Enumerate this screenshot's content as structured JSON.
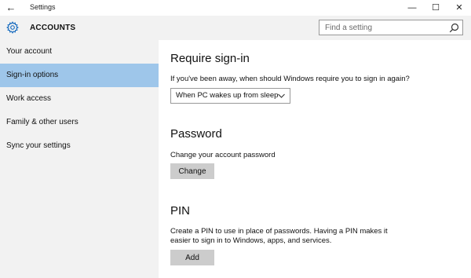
{
  "window": {
    "title": "Settings",
    "minimize_glyph": "—",
    "maximize_glyph": "☐",
    "close_glyph": "✕",
    "back_glyph": "←"
  },
  "header": {
    "icon": "gear-icon",
    "title": "ACCOUNTS"
  },
  "search": {
    "placeholder": "Find a setting",
    "icon": "search-icon"
  },
  "sidebar": {
    "items": [
      {
        "label": "Your account"
      },
      {
        "label": "Sign-in options",
        "selected": true
      },
      {
        "label": "Work access"
      },
      {
        "label": "Family & other users"
      },
      {
        "label": "Sync your settings"
      }
    ]
  },
  "content": {
    "require_signin": {
      "title": "Require sign-in",
      "question": "If you've been away, when should Windows require you to sign in again?",
      "selected_option": "When PC wakes up from sleep"
    },
    "password": {
      "title": "Password",
      "description": "Change your account password",
      "button_label": "Change"
    },
    "pin": {
      "title": "PIN",
      "description_line1": "Create a PIN to use in place of passwords. Having a PIN makes it",
      "description_line2": "easier to sign in to Windows, apps, and services.",
      "button_label": "Add"
    }
  },
  "colors": {
    "sidebar_bg": "#f2f2f2",
    "selected_item_bg": "#9ec6ea",
    "button_bg": "#cccccc",
    "accent": "#1e6fc0"
  }
}
